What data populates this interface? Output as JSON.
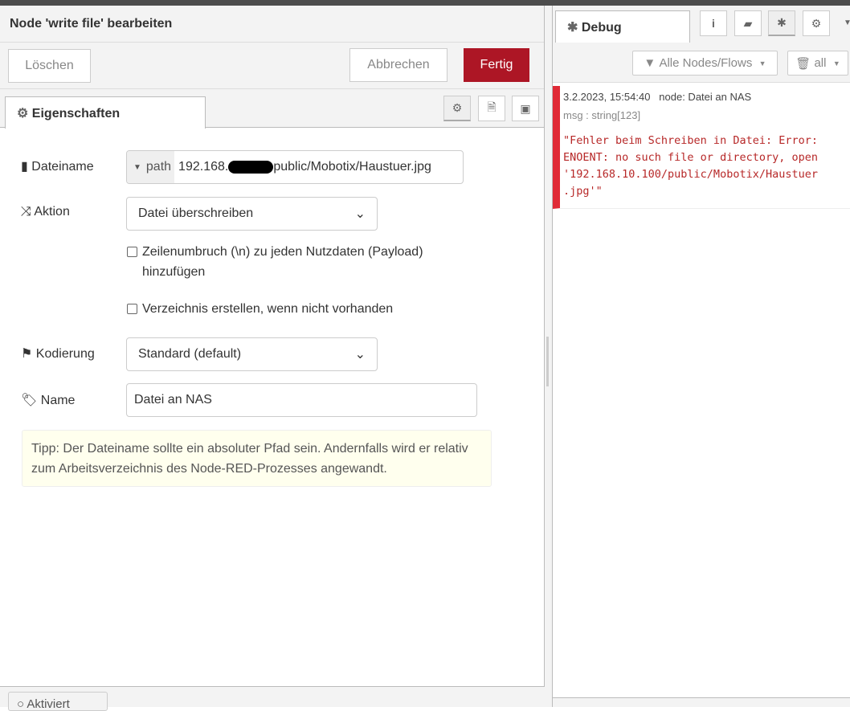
{
  "editor": {
    "title": "Node 'write file' bearbeiten",
    "delete_label": "Löschen",
    "cancel_label": "Abbrechen",
    "done_label": "Fertig",
    "done_color": "#ad1625",
    "tab_label": "Eigenschaften",
    "filename": {
      "label": "Dateiname",
      "type": "path",
      "value_prefix": "192.168.",
      "value_suffix": "public/Mobotix/Haustuer.jpg"
    },
    "action": {
      "label": "Aktion",
      "value": "Datei überschreiben"
    },
    "newline": {
      "label": "Zeilenumbruch (\\n) zu jeden Nutzdaten (Payload) hinzufügen",
      "checked": false
    },
    "createdir": {
      "label": "Verzeichnis erstellen, wenn nicht vorhanden",
      "checked": false
    },
    "encoding": {
      "label": "Kodierung",
      "value": "Standard (default)"
    },
    "name": {
      "label": "Name",
      "value": "Datei an NAS"
    },
    "tip": "Tipp: Der Dateiname sollte ein absoluter Pfad sein. Andernfalls wird er relativ zum Arbeitsverzeichnis des Node-RED-Prozesses angewandt.",
    "footer_toggle": "Aktiviert"
  },
  "debug": {
    "tab_label": "Debug",
    "filter_label": "Alle Nodes/Flows",
    "clear_label": "all",
    "message": {
      "timestamp": "3.2.2023, 15:54:40",
      "node": "node: Datei an NAS",
      "type": "msg : string[123]",
      "text": "\"Fehler beim Schreiben in Datei: Error:\nENOENT: no such file or directory, open\n'192.168.10.100/public/Mobotix/Haustuer\n.jpg'\""
    }
  }
}
